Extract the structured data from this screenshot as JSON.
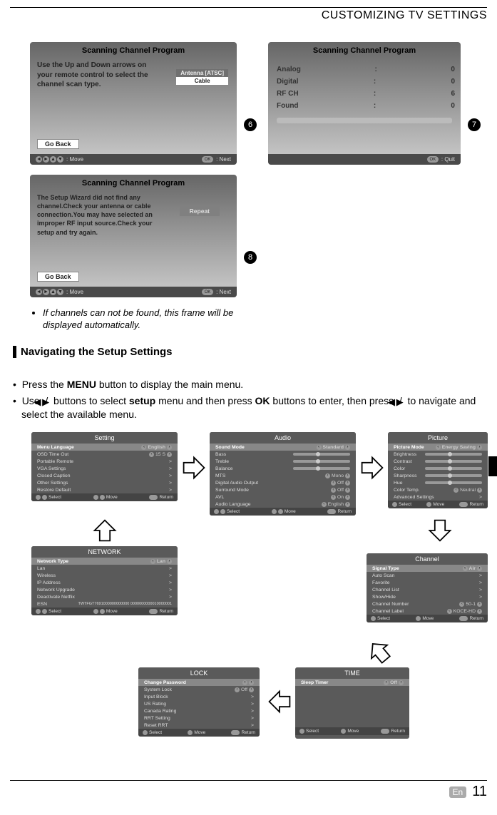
{
  "header": {
    "title": "CUSTOMIZING TV SETTINGS"
  },
  "callouts": {
    "n6": "6",
    "n7": "7",
    "n8": "8"
  },
  "osd6": {
    "title": "Scanning Channel Program",
    "msg": "Use the Up and Down arrows on your remote control to select the channel scan type.",
    "antenna_label": "Antenna [ATSC]",
    "cable_label": "Cable",
    "go_back": "Go Back",
    "move_label": "Move",
    "next_label": "Next"
  },
  "osd7": {
    "title": "Scanning Channel Program",
    "rows": [
      {
        "label": "Analog",
        "sep": ":",
        "val": "0"
      },
      {
        "label": "Digital",
        "sep": ":",
        "val": "0"
      },
      {
        "label": "RF CH",
        "sep": ":",
        "val": "6"
      },
      {
        "label": "Found",
        "sep": ":",
        "val": "0"
      }
    ],
    "quit_label": "Quit"
  },
  "osd8": {
    "title": "Scanning Channel Program",
    "msg": "The Setup Wizard did not find any channel.Check your antenna or cable connection.You may have selected an improper RF input source.Check your setup and try again.",
    "repeat_label": "Repeat",
    "go_back": "Go Back",
    "move_label": "Move",
    "next_label": "Next"
  },
  "note": "If channels can not be found, this frame will be displayed automatically.",
  "section_heading": "Navigating the Setup Settings",
  "instructions": {
    "line1_a": "Press the ",
    "line1_b": "MENU",
    "line1_c": " button to display the main menu.",
    "line2_a": "Use ",
    "line2_b": " buttons to select ",
    "line2_c": "setup",
    "line2_d": " menu and then press ",
    "line2_e": "OK",
    "line2_f": " buttons to enter, then press ",
    "line2_g": " to navigate and select the available menu."
  },
  "menus": {
    "setting": {
      "title": "Setting",
      "rows": [
        {
          "label": "Menu Language",
          "val": "English",
          "hl": true,
          "chev": true
        },
        {
          "label": "OSD Time Out",
          "val": "15 S",
          "chev": true
        },
        {
          "label": "Portable Remote",
          "val": ">"
        },
        {
          "label": "VGA Settings",
          "val": ">"
        },
        {
          "label": "Closed Caption",
          "val": ">"
        },
        {
          "label": "Other Settings",
          "val": ">"
        },
        {
          "label": "Restore Default",
          "val": ">"
        }
      ]
    },
    "audio": {
      "title": "Audio",
      "rows": [
        {
          "label": "Sound Mode",
          "val": "Standard",
          "hl": true,
          "chev": true
        },
        {
          "label": "Bass",
          "slider": true
        },
        {
          "label": "Treble",
          "slider": true
        },
        {
          "label": "Balance",
          "slider": true
        },
        {
          "label": "MTS",
          "val": "Mono",
          "chev": true
        },
        {
          "label": "Digital Audio Output",
          "val": "Off",
          "chev": true
        },
        {
          "label": "Surround Mode",
          "val": "Off",
          "chev": true
        },
        {
          "label": "AVL",
          "val": "On",
          "chev": true
        },
        {
          "label": "Audio Language",
          "val": "English",
          "chev": true
        }
      ]
    },
    "picture": {
      "title": "Picture",
      "rows": [
        {
          "label": "Picture Mode",
          "val": "Energy Saving",
          "hl": true,
          "chev": true
        },
        {
          "label": "Brightness",
          "slider": true
        },
        {
          "label": "Contrast",
          "slider": true
        },
        {
          "label": "Color",
          "slider": true
        },
        {
          "label": "Sharpness",
          "slider": true
        },
        {
          "label": "Hue",
          "slider": true
        },
        {
          "label": "Color Temp.",
          "val": "Neutral",
          "chev": true
        },
        {
          "label": "Advanced Settings",
          "val": ">"
        }
      ]
    },
    "network": {
      "title": "NETWORK",
      "rows": [
        {
          "label": "Network Type",
          "val": "Lan",
          "hl": true,
          "chev": true
        },
        {
          "label": "Lan",
          "val": ">"
        },
        {
          "label": "Wireless",
          "val": ">"
        },
        {
          "label": "IP Address",
          "val": ">"
        },
        {
          "label": "Network Upgrade",
          "val": ">"
        },
        {
          "label": "Deactivate Netflix",
          "val": ">"
        }
      ],
      "esn_label": "ESN",
      "esn_val": "TWTFGT7691000000000000\n0000000000010000001"
    },
    "channel": {
      "title": "Channel",
      "rows": [
        {
          "label": "Signal Type",
          "val": "Air",
          "hl": true,
          "chev": true
        },
        {
          "label": "Auto Scan",
          "val": ">"
        },
        {
          "label": "Favorite",
          "val": ">"
        },
        {
          "label": "Channel List",
          "val": ">"
        },
        {
          "label": "Show/Hide",
          "val": ">"
        },
        {
          "label": "Channel Number",
          "val": "50-1",
          "chev": true
        },
        {
          "label": "Channel Label",
          "val": "KOCE-HD",
          "chev": true
        }
      ]
    },
    "lock": {
      "title": "LOCK",
      "rows": [
        {
          "label": "Change Password",
          "val": "",
          "hl": true,
          "chev": true
        },
        {
          "label": "System Lock",
          "val": "Off",
          "chev": true
        },
        {
          "label": "Input Block",
          "val": ">"
        },
        {
          "label": "US Rating",
          "val": ">"
        },
        {
          "label": "Canada Rating",
          "val": ">"
        },
        {
          "label": "RRT Setting",
          "val": ">"
        },
        {
          "label": "Reset RRT",
          "val": ">"
        }
      ]
    },
    "time": {
      "title": "TIME",
      "rows": [
        {
          "label": "Sleep Timer",
          "val": "Off",
          "hl": true,
          "chev": true
        }
      ]
    },
    "footer": {
      "select": "Select",
      "move": "Move",
      "ret": "Return"
    }
  },
  "page_footer": {
    "lang": "En",
    "num": "11"
  }
}
